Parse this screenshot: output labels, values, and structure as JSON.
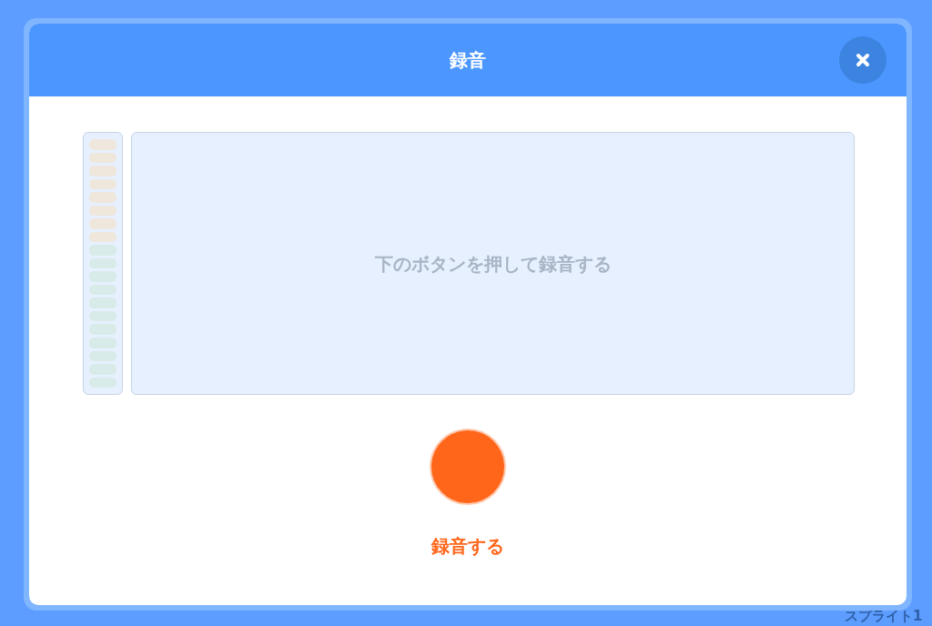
{
  "background": {
    "sprite_label": "スプライト1"
  },
  "modal": {
    "title": "録音",
    "prompt": "下のボタンを押して録音する",
    "record_button": {
      "label": "録音する"
    }
  }
}
